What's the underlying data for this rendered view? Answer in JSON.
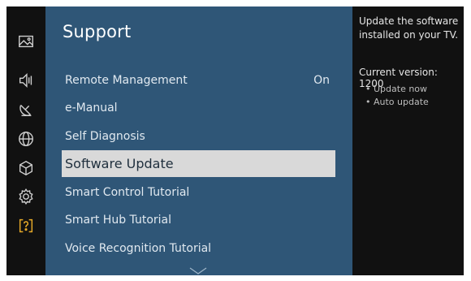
{
  "sidebar": {
    "icons": [
      "picture-icon",
      "sound-icon",
      "broadcast-icon",
      "network-icon",
      "system-icon",
      "settings-icon",
      "support-icon"
    ],
    "active_color": "#e6a928"
  },
  "panel": {
    "title": "Support",
    "items": [
      {
        "label": "Remote Management",
        "value": "On"
      },
      {
        "label": "e-Manual",
        "value": ""
      },
      {
        "label": "Self Diagnosis",
        "value": ""
      },
      {
        "label": "Software Update",
        "value": ""
      },
      {
        "label": "Smart Control Tutorial",
        "value": ""
      },
      {
        "label": "Smart Hub Tutorial",
        "value": ""
      },
      {
        "label": "Voice Recognition Tutorial",
        "value": ""
      }
    ],
    "selected_index": 3
  },
  "info": {
    "description": "Update the software installed on your TV.",
    "current_version": "Current version: 1200",
    "options": [
      "Update now",
      "Auto update"
    ]
  },
  "colors": {
    "panel_bg": "#2f5677",
    "selected_bg": "#d9d9d9",
    "screen_bg": "#111111"
  }
}
